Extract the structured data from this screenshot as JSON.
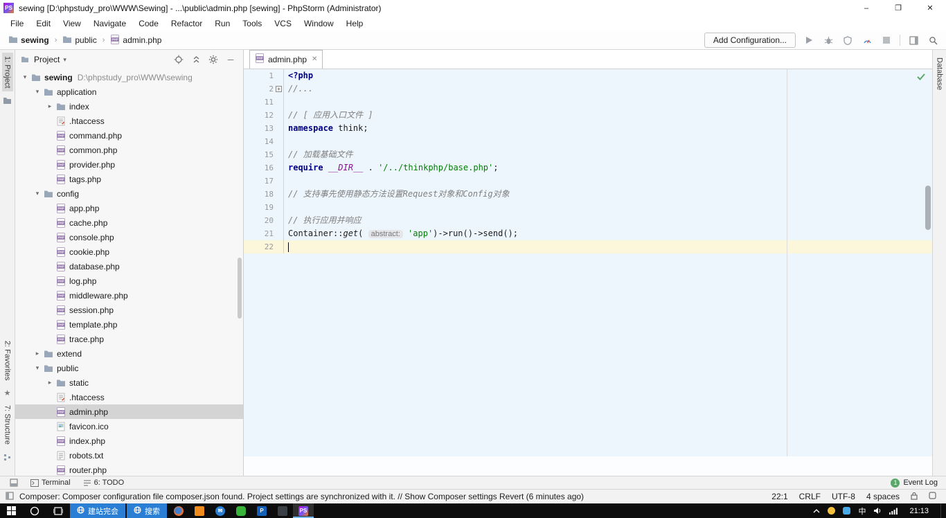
{
  "window": {
    "title": "sewing [D:\\phpstudy_pro\\WWW\\Sewing] - ...\\public\\admin.php [sewing] - PhpStorm (Administrator)",
    "logo": "PS",
    "controls": {
      "minimize": "–",
      "maximize": "❐",
      "close": "✕"
    }
  },
  "menu": [
    "File",
    "Edit",
    "View",
    "Navigate",
    "Code",
    "Refactor",
    "Run",
    "Tools",
    "VCS",
    "Window",
    "Help"
  ],
  "navbar": {
    "breadcrumbs": [
      {
        "label": "sewing",
        "icon": "folder",
        "bold": true
      },
      {
        "label": "public",
        "icon": "folder",
        "bold": false
      },
      {
        "label": "admin.php",
        "icon": "php",
        "bold": false
      }
    ],
    "add_configuration": "Add Configuration..."
  },
  "left_strip": {
    "top": [
      "1: Project"
    ],
    "bottom": [
      "2: Favorites",
      "7: Structure"
    ]
  },
  "right_strip": [
    "Database"
  ],
  "project_panel": {
    "title": "Project",
    "tree": [
      {
        "label": "sewing",
        "suffix": "D:\\phpstudy_pro\\WWW\\sewing",
        "level": 0,
        "icon": "folder",
        "arrow": "open",
        "bold": true
      },
      {
        "label": "application",
        "level": 1,
        "icon": "folder",
        "arrow": "open"
      },
      {
        "label": "index",
        "level": 2,
        "icon": "folder",
        "arrow": "closed"
      },
      {
        "label": ".htaccess",
        "level": 2,
        "icon": "htaccess"
      },
      {
        "label": "command.php",
        "level": 2,
        "icon": "php"
      },
      {
        "label": "common.php",
        "level": 2,
        "icon": "php"
      },
      {
        "label": "provider.php",
        "level": 2,
        "icon": "php"
      },
      {
        "label": "tags.php",
        "level": 2,
        "icon": "php"
      },
      {
        "label": "config",
        "level": 1,
        "icon": "folder",
        "arrow": "open"
      },
      {
        "label": "app.php",
        "level": 2,
        "icon": "php"
      },
      {
        "label": "cache.php",
        "level": 2,
        "icon": "php"
      },
      {
        "label": "console.php",
        "level": 2,
        "icon": "php"
      },
      {
        "label": "cookie.php",
        "level": 2,
        "icon": "php"
      },
      {
        "label": "database.php",
        "level": 2,
        "icon": "php"
      },
      {
        "label": "log.php",
        "level": 2,
        "icon": "php"
      },
      {
        "label": "middleware.php",
        "level": 2,
        "icon": "php"
      },
      {
        "label": "session.php",
        "level": 2,
        "icon": "php"
      },
      {
        "label": "template.php",
        "level": 2,
        "icon": "php"
      },
      {
        "label": "trace.php",
        "level": 2,
        "icon": "php"
      },
      {
        "label": "extend",
        "level": 1,
        "icon": "folder",
        "arrow": "closed"
      },
      {
        "label": "public",
        "level": 1,
        "icon": "folder",
        "arrow": "open"
      },
      {
        "label": "static",
        "level": 2,
        "icon": "folder",
        "arrow": "closed"
      },
      {
        "label": ".htaccess",
        "level": 2,
        "icon": "htaccess"
      },
      {
        "label": "admin.php",
        "level": 2,
        "icon": "php",
        "selected": true
      },
      {
        "label": "favicon.ico",
        "level": 2,
        "icon": "image"
      },
      {
        "label": "index.php",
        "level": 2,
        "icon": "php"
      },
      {
        "label": "robots.txt",
        "level": 2,
        "icon": "text"
      },
      {
        "label": "router.php",
        "level": 2,
        "icon": "php"
      }
    ]
  },
  "editor": {
    "tab": "admin.php",
    "lines": [
      {
        "num": "1",
        "tokens": [
          [
            "tag",
            "<?php"
          ]
        ]
      },
      {
        "num": "2",
        "fold": true,
        "tokens": [
          [
            "cm",
            "//..."
          ]
        ]
      },
      {
        "num": "11",
        "tokens": []
      },
      {
        "num": "12",
        "tokens": [
          [
            "cm",
            "// [ 应用入口文件 ]"
          ]
        ]
      },
      {
        "num": "13",
        "tokens": [
          [
            "kw",
            "namespace"
          ],
          [
            "pl",
            " think;"
          ]
        ]
      },
      {
        "num": "14",
        "tokens": []
      },
      {
        "num": "15",
        "tokens": [
          [
            "cm",
            "// 加载基础文件"
          ]
        ]
      },
      {
        "num": "16",
        "tokens": [
          [
            "kw",
            "require"
          ],
          [
            "pl",
            " "
          ],
          [
            "magic",
            "__DIR__"
          ],
          [
            "pl",
            " . "
          ],
          [
            "str",
            "'/../thinkphp/base.php'"
          ],
          [
            "pl",
            ";"
          ]
        ]
      },
      {
        "num": "17",
        "tokens": []
      },
      {
        "num": "18",
        "tokens": [
          [
            "cm",
            "// 支持事先使用静态方法设置Request对象和Config对象"
          ]
        ]
      },
      {
        "num": "19",
        "tokens": []
      },
      {
        "num": "20",
        "tokens": [
          [
            "cm",
            "// 执行应用并响应"
          ]
        ]
      },
      {
        "num": "21",
        "tokens": [
          [
            "pl",
            "Container::"
          ],
          [
            "fn",
            "get"
          ],
          [
            "pl",
            "( "
          ],
          [
            "hint",
            "abstract:"
          ],
          [
            "pl",
            " "
          ],
          [
            "str",
            "'app'"
          ],
          [
            "pl",
            ")->run()->send();"
          ]
        ]
      },
      {
        "num": "22",
        "current": true,
        "caret": true,
        "tokens": []
      }
    ]
  },
  "bottom_bar": {
    "items": [
      "Terminal",
      "6: TODO"
    ],
    "event_log": "Event Log",
    "badge": "1"
  },
  "status_bar": {
    "message": "Composer: Composer configuration file composer.json found. Project settings are synchronized with it. // Show Composer settings Revert (6 minutes ago)",
    "caret": "22:1",
    "line_sep": "CRLF",
    "encoding": "UTF-8",
    "indent": "4 spaces"
  },
  "taskbar": {
    "apps": [
      {
        "name": "jianzhan-window",
        "label": "建站完会"
      },
      {
        "name": "sousuo-window",
        "label": "搜索"
      }
    ],
    "ime": "中",
    "time": "21:13"
  }
}
